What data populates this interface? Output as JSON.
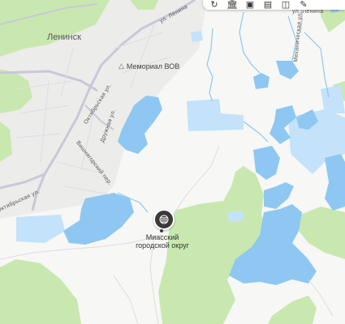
{
  "labels": {
    "city": "Ленинск",
    "memorial": "Мемориал ВОВ",
    "okrug_line1": "Миасский",
    "okrug_line2": "городской округ",
    "street_lenina_top": "ул. Ленина",
    "street_lenina_right": "ул. Ленина",
    "street_oktyabrskaya": "Октябрьская ул.",
    "street_druzhnaya": "Дружная ул.",
    "street_vishnyagovsky": "Вишнягорский пер.",
    "street_oktyabrskaya_low": "Октябрьская ул.",
    "street_mekhanicheskaya": "Механическая ул."
  },
  "icons": {
    "memorial": "monument-icon",
    "poi": "pine-tree-icon",
    "toolbar": [
      "refresh-icon",
      "museum-icon",
      "camera-icon",
      "bus-icon",
      "layers-icon",
      "ruler-icon"
    ]
  },
  "colors": {
    "land": "#f7f7f5",
    "forest": "#c9e8b0",
    "water": "#8ec8f2",
    "water_light": "#c4e2fa",
    "road": "#c8c8d8",
    "urban": "#ececea"
  }
}
